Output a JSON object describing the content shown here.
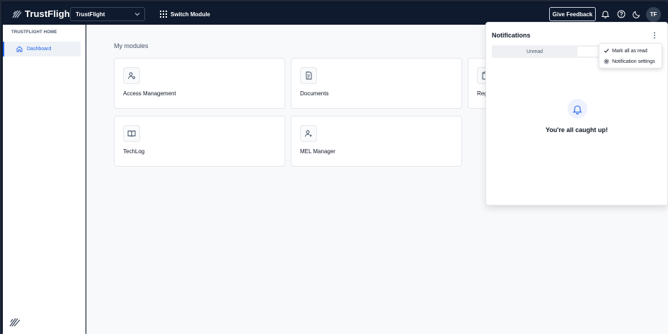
{
  "topbar": {
    "brand": "TrustFlight",
    "org_selected": "TrustFlight",
    "switch_module_label": "Switch Module",
    "feedback_label": "Give Feedback",
    "avatar_initials": "TF"
  },
  "sidebar": {
    "section_title": "TRUSTFLIGHT HOME",
    "items": [
      {
        "label": "Dashboard",
        "icon": "home-icon",
        "active": true
      }
    ]
  },
  "main": {
    "section_title": "My modules",
    "modules": [
      {
        "label": "Access Management",
        "icon": "user-gear-icon"
      },
      {
        "label": "Documents",
        "icon": "document-icon"
      },
      {
        "label": "Reg",
        "icon": "clipboard-icon"
      },
      {
        "label": "TechLog",
        "icon": "book-icon"
      },
      {
        "label": "MEL Manager",
        "icon": "user-plus-icon"
      }
    ]
  },
  "notifications": {
    "title": "Notifications",
    "tabs": [
      {
        "label": "Unread"
      }
    ],
    "menu": [
      {
        "label": "Mark all as read",
        "icon": "check-icon"
      },
      {
        "label": "Notification settings",
        "icon": "gear-icon"
      }
    ],
    "empty_message": "You're all caught up!"
  },
  "colors": {
    "topbar": "#0f1a2e",
    "accent": "#2563eb",
    "background": "#f8f9fb"
  }
}
